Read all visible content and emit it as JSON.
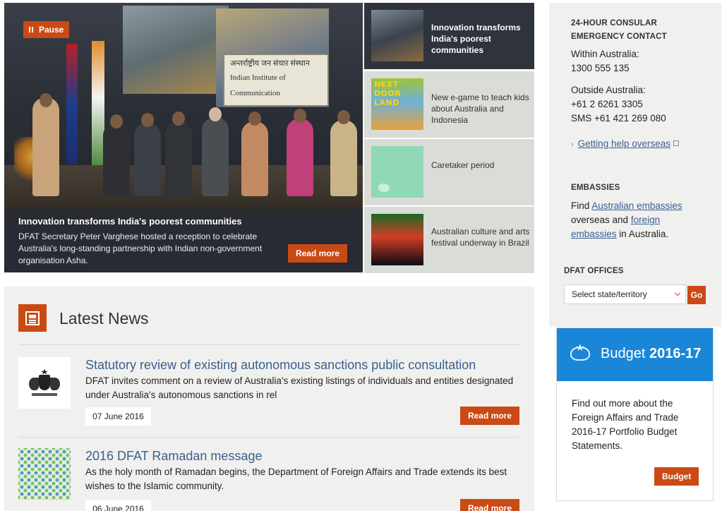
{
  "hero": {
    "pause_label": "Pause",
    "banner_line1": "अन्तर्राष्ट्रीय जन संचार संस्थान",
    "banner_line2": "Indian Institute of",
    "banner_line3": "Communication",
    "caption_title": "Innovation transforms India's poorest communities",
    "caption_text": "DFAT Secretary Peter Varghese hosted a reception to celebrate Australia's long-standing partnership with Indian non-government organisation Asha.",
    "read_more": "Read more"
  },
  "carousel": [
    {
      "title": "Innovation transforms India's poorest communities",
      "active": true
    },
    {
      "title": "New e-game to teach kids about Australia and Indonesia",
      "image_text": "NEXT DOOR LAND",
      "active": false
    },
    {
      "title": "Caretaker period",
      "active": false
    },
    {
      "title": "Australian culture and arts festival underway in Brazil",
      "active": false
    }
  ],
  "news": {
    "heading": "Latest News",
    "items": [
      {
        "title": "Statutory review of existing autonomous sanctions public consultation",
        "description": "DFAT invites comment on a review of Australia's existing listings of individuals and entities designated under Australia's autonomous sanctions in rel",
        "date": "07 June 2016",
        "read_more": "Read more"
      },
      {
        "title": "2016 DFAT Ramadan message",
        "description": "As the holy month of Ramadan begins, the Department of Foreign Affairs and Trade extends its best wishes to the Islamic community.",
        "date": "06 June 2016",
        "read_more": "Read more"
      }
    ]
  },
  "consular": {
    "heading_line1": "24-HOUR CONSULAR",
    "heading_line2": "EMERGENCY CONTACT",
    "within_label": "Within Australia:",
    "within_phone": "1300 555 135",
    "outside_label": "Outside Australia:",
    "outside_phone": "+61 2 6261 3305",
    "outside_sms": "SMS +61 421 269 080",
    "help_link": "Getting help overseas",
    "embassies_heading": "EMBASSIES",
    "embassies_find": "Find",
    "embassies_link1": "Australian embassies",
    "embassies_mid": "overseas and",
    "embassies_link2a": "foreign",
    "embassies_link2b": "embassies",
    "embassies_end": "in Australia.",
    "offices_heading": "DFAT OFFICES",
    "select_value": "Select state/territory",
    "go_label": "Go"
  },
  "budget": {
    "title_light": "Budget",
    "title_bold": "2016-17",
    "text": "Find out more about the Foreign Affairs and Trade 2016-17 Portfolio Budget Statements.",
    "button": "Budget"
  },
  "colors": {
    "accent": "#c94a14",
    "link": "#3b5f91",
    "budget_blue": "#1a86d8",
    "panel_grey": "#f0f0ee"
  }
}
